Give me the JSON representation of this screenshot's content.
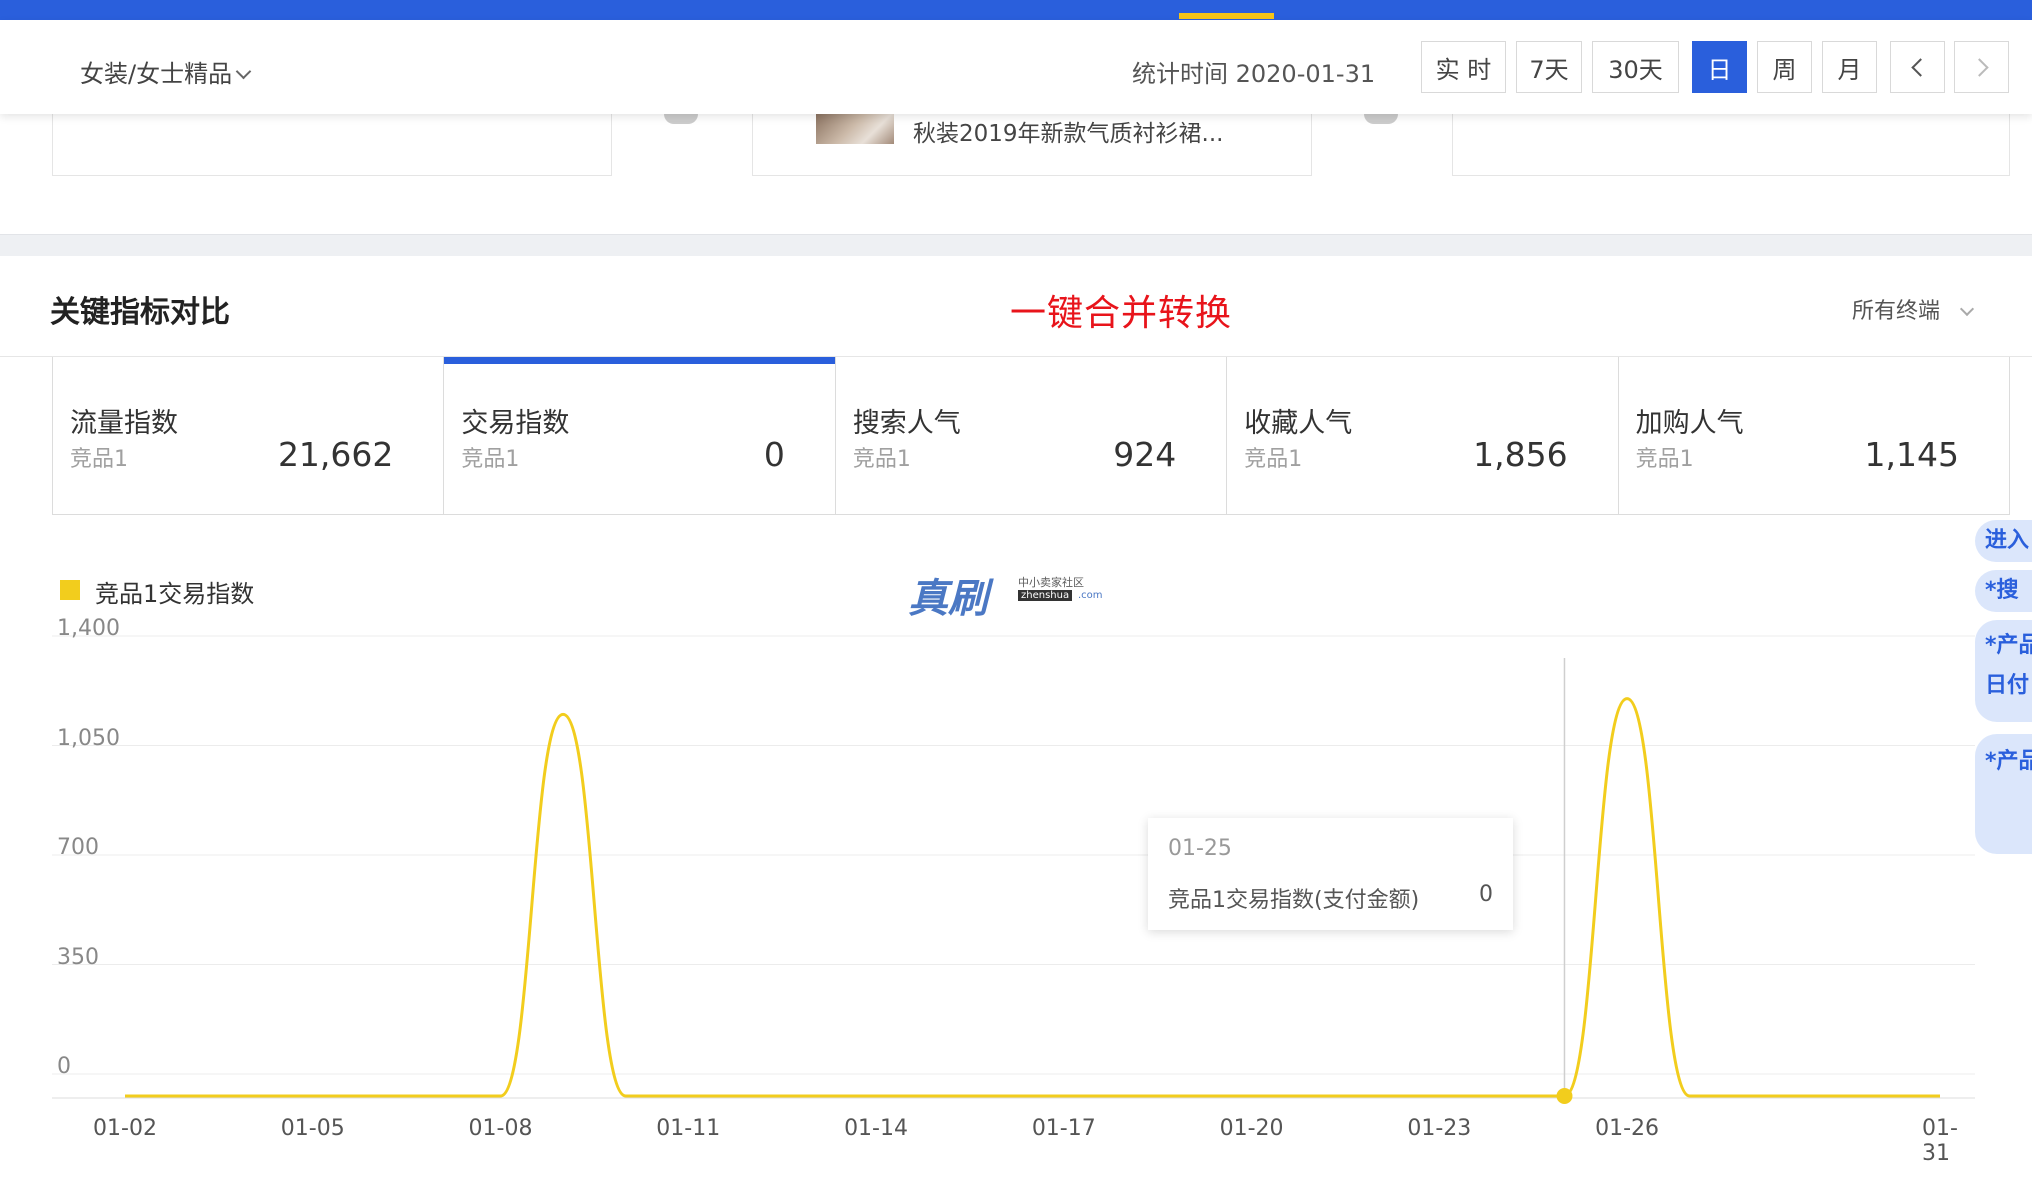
{
  "header": {
    "category": "女装/女士精品",
    "stat_time": "统计时间 2020-01-31",
    "ranges": [
      "实 时",
      "7天",
      "30天",
      "日",
      "周",
      "月"
    ],
    "active_range": "日"
  },
  "products": {
    "name": "秋装2019年新款气质衬衫裙..."
  },
  "section": {
    "title": "关键指标对比",
    "promo": "一键合并转换",
    "terminal": "所有终端"
  },
  "metrics": [
    {
      "label": "流量指数",
      "sub": "竞品1",
      "value": "21,662"
    },
    {
      "label": "交易指数",
      "sub": "竞品1",
      "value": "0"
    },
    {
      "label": "搜索人气",
      "sub": "竞品1",
      "value": "924"
    },
    {
      "label": "收藏人气",
      "sub": "竞品1",
      "value": "1,856"
    },
    {
      "label": "加购人气",
      "sub": "竞品1",
      "value": "1,145"
    }
  ],
  "active_metric": 1,
  "watermark": {
    "main": "真刷",
    "sub": "中小卖家社区",
    "domain": "zhenshua",
    "tld": ".com"
  },
  "tooltip": {
    "date": "01-25",
    "name": "竞品1交易指数(支付金额)",
    "value": "0"
  },
  "side_panel": [
    "进入",
    "*搜",
    "*产品",
    "日付",
    "*产品"
  ],
  "chart_data": {
    "type": "line",
    "legend": "竞品1交易指数",
    "color": "#f2cd1d",
    "yticks": [
      "1,400",
      "1,050",
      "700",
      "350",
      "0"
    ],
    "ylim": [
      0,
      1400
    ],
    "xticks": [
      "01-02",
      "01-05",
      "01-08",
      "01-11",
      "01-14",
      "01-17",
      "01-20",
      "01-23",
      "01-26",
      "01-31"
    ],
    "x": [
      "01-02",
      "01-03",
      "01-04",
      "01-05",
      "01-06",
      "01-07",
      "01-08",
      "01-09",
      "01-10",
      "01-11",
      "01-12",
      "01-13",
      "01-14",
      "01-15",
      "01-16",
      "01-17",
      "01-18",
      "01-19",
      "01-20",
      "01-21",
      "01-22",
      "01-23",
      "01-24",
      "01-25",
      "01-26",
      "01-27",
      "01-28",
      "01-29",
      "01-30",
      "01-31"
    ],
    "series": [
      {
        "values": [
          0,
          0,
          0,
          0,
          0,
          0,
          0,
          1220,
          0,
          0,
          0,
          0,
          0,
          0,
          0,
          0,
          0,
          0,
          0,
          0,
          0,
          0,
          0,
          0,
          1270,
          0,
          0,
          0,
          0,
          0
        ]
      }
    ],
    "highlight_index": 23,
    "grid": true
  }
}
